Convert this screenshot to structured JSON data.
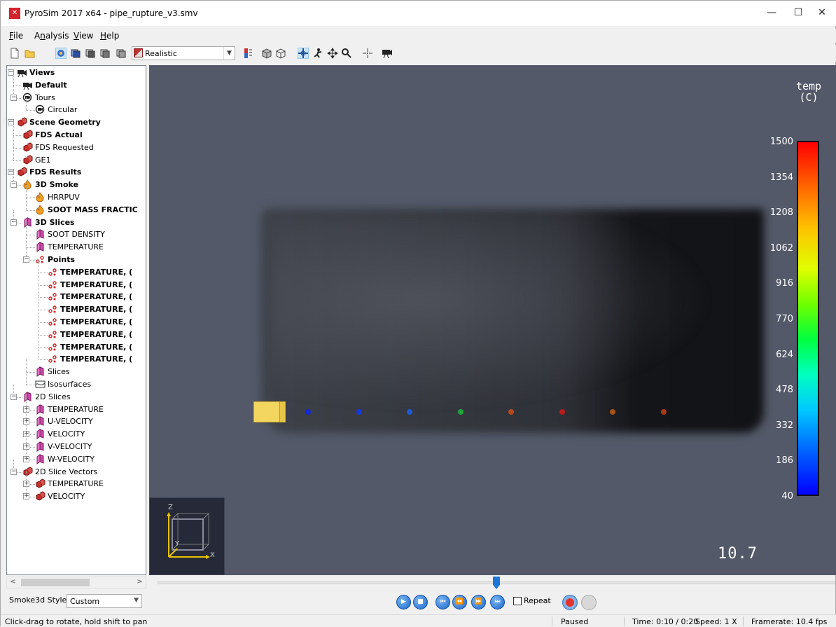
{
  "window": {
    "title": "PyroSim 2017 x64 - pipe_rupture_v3.smv",
    "app_icon_glyph": "✕",
    "controls": {
      "minimize": "—",
      "maximize": "☐",
      "close": "✕"
    }
  },
  "menu": {
    "items": [
      {
        "label": "File",
        "mnemonic": "F",
        "rest": "ile"
      },
      {
        "label": "Analysis",
        "mnemonic": "n",
        "rest_before": "A",
        "rest": "alysis"
      },
      {
        "label": "View",
        "mnemonic": "V",
        "rest": "iew"
      },
      {
        "label": "Help",
        "mnemonic": "H",
        "rest": "elp"
      }
    ]
  },
  "toolbar": {
    "render_mode": "Realistic",
    "icons": [
      "new-file-icon",
      "open-folder-icon",
      "navigate-view-icon",
      "view-top-icon",
      "view-front-icon",
      "view-side-icon",
      "view-iso-icon",
      "render-mode-icon",
      "colorbar-icon",
      "solid-objects-icon",
      "wire-objects-icon",
      "orbit-icon",
      "roam-icon",
      "pan-icon",
      "zoom-icon",
      "select-icon",
      "camera-icon"
    ]
  },
  "tree": {
    "nodes": [
      {
        "label": "Views",
        "bold": true,
        "level": 0,
        "icon": "views-camera-icon",
        "expander": "−"
      },
      {
        "label": "Default",
        "bold": true,
        "level": 1,
        "icon": "camera-icon"
      },
      {
        "label": "Tours",
        "bold": false,
        "level": 1,
        "icon": "tour-icon",
        "expander": "−"
      },
      {
        "label": "Circular",
        "bold": false,
        "level": 2,
        "icon": "tour-icon"
      },
      {
        "label": "Scene Geometry",
        "bold": true,
        "level": 0,
        "icon": "geometry-icon",
        "expander": "−"
      },
      {
        "label": "FDS Actual",
        "bold": true,
        "level": 1,
        "icon": "geometry-icon"
      },
      {
        "label": "FDS Requested",
        "bold": false,
        "level": 1,
        "icon": "geometry-icon"
      },
      {
        "label": "GE1",
        "bold": false,
        "level": 1,
        "icon": "geometry-icon"
      },
      {
        "label": "FDS Results",
        "bold": true,
        "level": 0,
        "icon": "geometry-icon",
        "expander": "−"
      },
      {
        "label": "3D Smoke",
        "bold": true,
        "level": 1,
        "icon": "fire-icon",
        "expander": "−"
      },
      {
        "label": "HRRPUV",
        "bold": false,
        "level": 2,
        "icon": "fire-icon"
      },
      {
        "label": "SOOT MASS FRACTIC",
        "bold": true,
        "level": 2,
        "icon": "fire-icon"
      },
      {
        "label": "3D Slices",
        "bold": true,
        "level": 1,
        "icon": "slice-icon",
        "expander": "−"
      },
      {
        "label": "SOOT DENSITY",
        "bold": false,
        "level": 2,
        "icon": "slice-icon"
      },
      {
        "label": "TEMPERATURE",
        "bold": false,
        "level": 2,
        "icon": "slice-icon"
      },
      {
        "label": "Points",
        "bold": true,
        "level": 2,
        "icon": "points-icon",
        "expander": "−"
      },
      {
        "label": "TEMPERATURE, (",
        "bold": true,
        "level": 3,
        "icon": "points-icon"
      },
      {
        "label": "TEMPERATURE, (",
        "bold": true,
        "level": 3,
        "icon": "points-icon"
      },
      {
        "label": "TEMPERATURE, (",
        "bold": true,
        "level": 3,
        "icon": "points-icon"
      },
      {
        "label": "TEMPERATURE, (",
        "bold": true,
        "level": 3,
        "icon": "points-icon"
      },
      {
        "label": "TEMPERATURE, (",
        "bold": true,
        "level": 3,
        "icon": "points-icon"
      },
      {
        "label": "TEMPERATURE, (",
        "bold": true,
        "level": 3,
        "icon": "points-icon"
      },
      {
        "label": "TEMPERATURE, (",
        "bold": true,
        "level": 3,
        "icon": "points-icon"
      },
      {
        "label": "TEMPERATURE, (",
        "bold": true,
        "level": 3,
        "icon": "points-icon"
      },
      {
        "label": "Slices",
        "bold": false,
        "level": 2,
        "icon": "slice-icon"
      },
      {
        "label": "Isosurfaces",
        "bold": false,
        "level": 2,
        "icon": "isosurface-icon"
      },
      {
        "label": "2D Slices",
        "bold": false,
        "level": 1,
        "icon": "slice-icon",
        "expander": "−"
      },
      {
        "label": "TEMPERATURE",
        "bold": false,
        "level": 2,
        "icon": "slice-icon",
        "expander": "+"
      },
      {
        "label": "U-VELOCITY",
        "bold": false,
        "level": 2,
        "icon": "slice-icon",
        "expander": "+"
      },
      {
        "label": "VELOCITY",
        "bold": false,
        "level": 2,
        "icon": "slice-icon",
        "expander": "+"
      },
      {
        "label": "V-VELOCITY",
        "bold": false,
        "level": 2,
        "icon": "slice-icon",
        "expander": "+"
      },
      {
        "label": "W-VELOCITY",
        "bold": false,
        "level": 2,
        "icon": "slice-icon",
        "expander": "+"
      },
      {
        "label": "2D Slice Vectors",
        "bold": false,
        "level": 1,
        "icon": "geometry-icon",
        "expander": "−"
      },
      {
        "label": "TEMPERATURE",
        "bold": false,
        "level": 2,
        "icon": "geometry-icon",
        "expander": "+"
      },
      {
        "label": "VELOCITY",
        "bold": false,
        "level": 2,
        "icon": "geometry-icon",
        "expander": "+"
      }
    ]
  },
  "smoke3d_style": {
    "label": "Smoke3d Style:",
    "value": "Custom"
  },
  "viewport": {
    "legend": {
      "title_line1": "temp",
      "title_line2": "(C)",
      "ticks": [
        "1500",
        "1354",
        "1208",
        "1062",
        "916",
        "770",
        "624",
        "478",
        "332",
        "186",
        "40"
      ]
    },
    "probe_colors": [
      "#1428d8",
      "#1438e0",
      "#1c5ad8",
      "#1ea43a",
      "#b84a1a",
      "#b81c1c",
      "#a85214",
      "#a83a14"
    ],
    "axes": {
      "z": "Z",
      "y": "Y",
      "x": "X"
    },
    "time_readout": "10.7"
  },
  "playback": {
    "progress": 0.5,
    "buttons": [
      "play-icon",
      "stop-icon",
      "skip-to-start-icon",
      "step-back-icon",
      "step-forward-icon",
      "skip-to-end-icon"
    ],
    "repeat_label": "Repeat",
    "repeat_checked": false
  },
  "status": {
    "hint": "Click-drag to rotate, hold shift to pan",
    "state": "Paused",
    "time": "Time: 0:10 / 0:20",
    "speed": "Speed: 1 X",
    "framerate": "Framerate: 10.4 fps"
  }
}
